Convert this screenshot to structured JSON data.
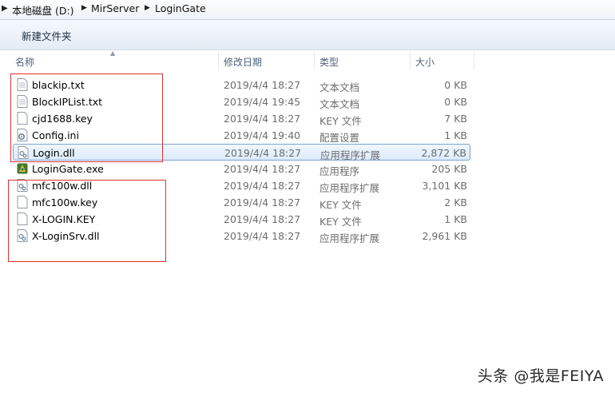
{
  "address": {
    "crumbs": [
      "本地磁盘 (D:)",
      "MirServer",
      "LoginGate"
    ]
  },
  "toolbar": {
    "new_folder_label": "新建文件夹"
  },
  "columns": {
    "name": "名称",
    "date": "修改日期",
    "type": "类型",
    "size": "大小"
  },
  "files": [
    {
      "name": "blackip.txt",
      "date": "2019/4/4 18:27",
      "type": "文本文档",
      "size": "0 KB",
      "icon": "text-file-icon"
    },
    {
      "name": "BlockIPList.txt",
      "date": "2019/4/4 19:45",
      "type": "文本文档",
      "size": "0 KB",
      "icon": "text-file-icon"
    },
    {
      "name": "cjd1688.key",
      "date": "2019/4/4 18:27",
      "type": "KEY 文件",
      "size": "7 KB",
      "icon": "blank-file-icon"
    },
    {
      "name": "Config.ini",
      "date": "2019/4/4 19:40",
      "type": "配置设置",
      "size": "1 KB",
      "icon": "config-file-icon"
    },
    {
      "name": "Login.dll",
      "date": "2019/4/4 18:27",
      "type": "应用程序扩展",
      "size": "2,872 KB",
      "icon": "dll-file-icon",
      "selected": true
    },
    {
      "name": "LoginGate.exe",
      "date": "2019/4/4 18:27",
      "type": "应用程序",
      "size": "205 KB",
      "icon": "exe-file-icon"
    },
    {
      "name": "mfc100w.dll",
      "date": "2019/4/4 18:27",
      "type": "应用程序扩展",
      "size": "3,101 KB",
      "icon": "dll-file-icon"
    },
    {
      "name": "mfc100w.key",
      "date": "2019/4/4 18:27",
      "type": "KEY 文件",
      "size": "2 KB",
      "icon": "blank-file-icon"
    },
    {
      "name": "X-LOGIN.KEY",
      "date": "2019/4/4 18:27",
      "type": "KEY 文件",
      "size": "1 KB",
      "icon": "blank-file-icon"
    },
    {
      "name": "X-LoginSrv.dll",
      "date": "2019/4/4 18:27",
      "type": "应用程序扩展",
      "size": "2,961 KB",
      "icon": "dll-file-icon"
    }
  ],
  "colors": {
    "annotation_red": "#e0302e",
    "selection_border": "#7da2ce"
  },
  "watermark": "头条 @我是FEIYA"
}
